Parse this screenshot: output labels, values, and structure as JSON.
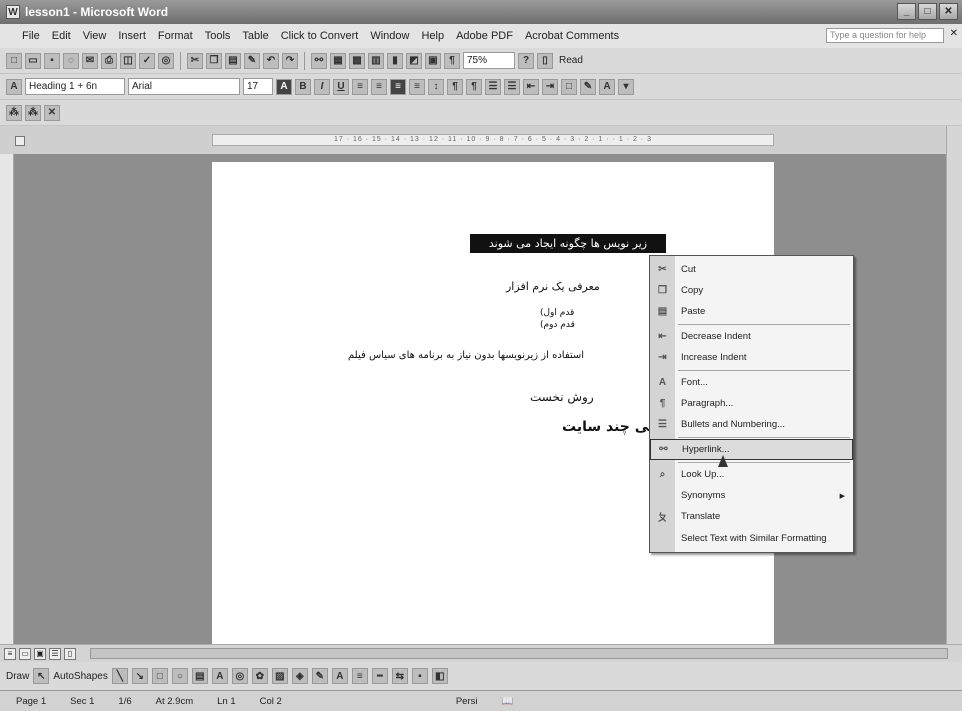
{
  "window": {
    "title": "lesson1 - Microsoft Word",
    "app_icon": "word-icon"
  },
  "menubar": {
    "items": [
      "File",
      "Edit",
      "View",
      "Insert",
      "Format",
      "Tools",
      "Table",
      "Click to Convert",
      "Window",
      "Help",
      "Adobe PDF",
      "Acrobat Comments"
    ],
    "help_placeholder": "Type a question for help"
  },
  "standard_toolbar": {
    "zoom": "75%",
    "read_label": "Read"
  },
  "formatting_toolbar": {
    "style": "Heading 1 + 6n",
    "font": "Arial",
    "size": "17"
  },
  "ruler": {
    "ticks": "17 · 16 · 15 · 14 · 13 · 12 · 11 · 10 · 9 · 8 · 7 · 6 · 5 · 4 · 3 · 2 · 1 · · 1 · 2 · 3"
  },
  "document": {
    "selected_heading": "زیر نویس ها چگونه ایجاد می شوند",
    "line2": "معرفی یک نرم افزار",
    "line3": "قدم اول)",
    "line4": "قدم دوم)",
    "line5": "استفاده از زیرنویسها بدون نیاز به برنامه های سیاس فیلم",
    "line6": "روش نخست",
    "line7": "معرفی چند سایت"
  },
  "context_menu": {
    "items": [
      {
        "label": "Cut",
        "icon": "scissors-icon"
      },
      {
        "label": "Copy",
        "icon": "copy-icon"
      },
      {
        "label": "Paste",
        "icon": "paste-icon"
      },
      {
        "label": "Decrease Indent",
        "icon": "decrease-indent-icon"
      },
      {
        "label": "Increase Indent",
        "icon": "increase-indent-icon"
      },
      {
        "label": "Font...",
        "icon": "font-icon"
      },
      {
        "label": "Paragraph...",
        "icon": "paragraph-icon"
      },
      {
        "label": "Bullets and Numbering...",
        "icon": "bullets-icon"
      },
      {
        "label": "Hyperlink...",
        "icon": "hyperlink-icon",
        "highlighted": true
      },
      {
        "label": "Look Up...",
        "icon": "lookup-icon"
      },
      {
        "label": "Synonyms",
        "icon": "",
        "submenu": true
      },
      {
        "label": "Translate",
        "icon": "translate-icon"
      },
      {
        "label": "Select Text with Similar Formatting",
        "icon": ""
      }
    ]
  },
  "drawing_toolbar": {
    "draw_label": "Draw",
    "autoshapes_label": "AutoShapes"
  },
  "statusbar": {
    "page": "Page 1",
    "sec": "Sec 1",
    "of": "1/6",
    "at": "At 2.9cm",
    "ln": "Ln 1",
    "col": "Col 2",
    "lang": "Persi"
  }
}
